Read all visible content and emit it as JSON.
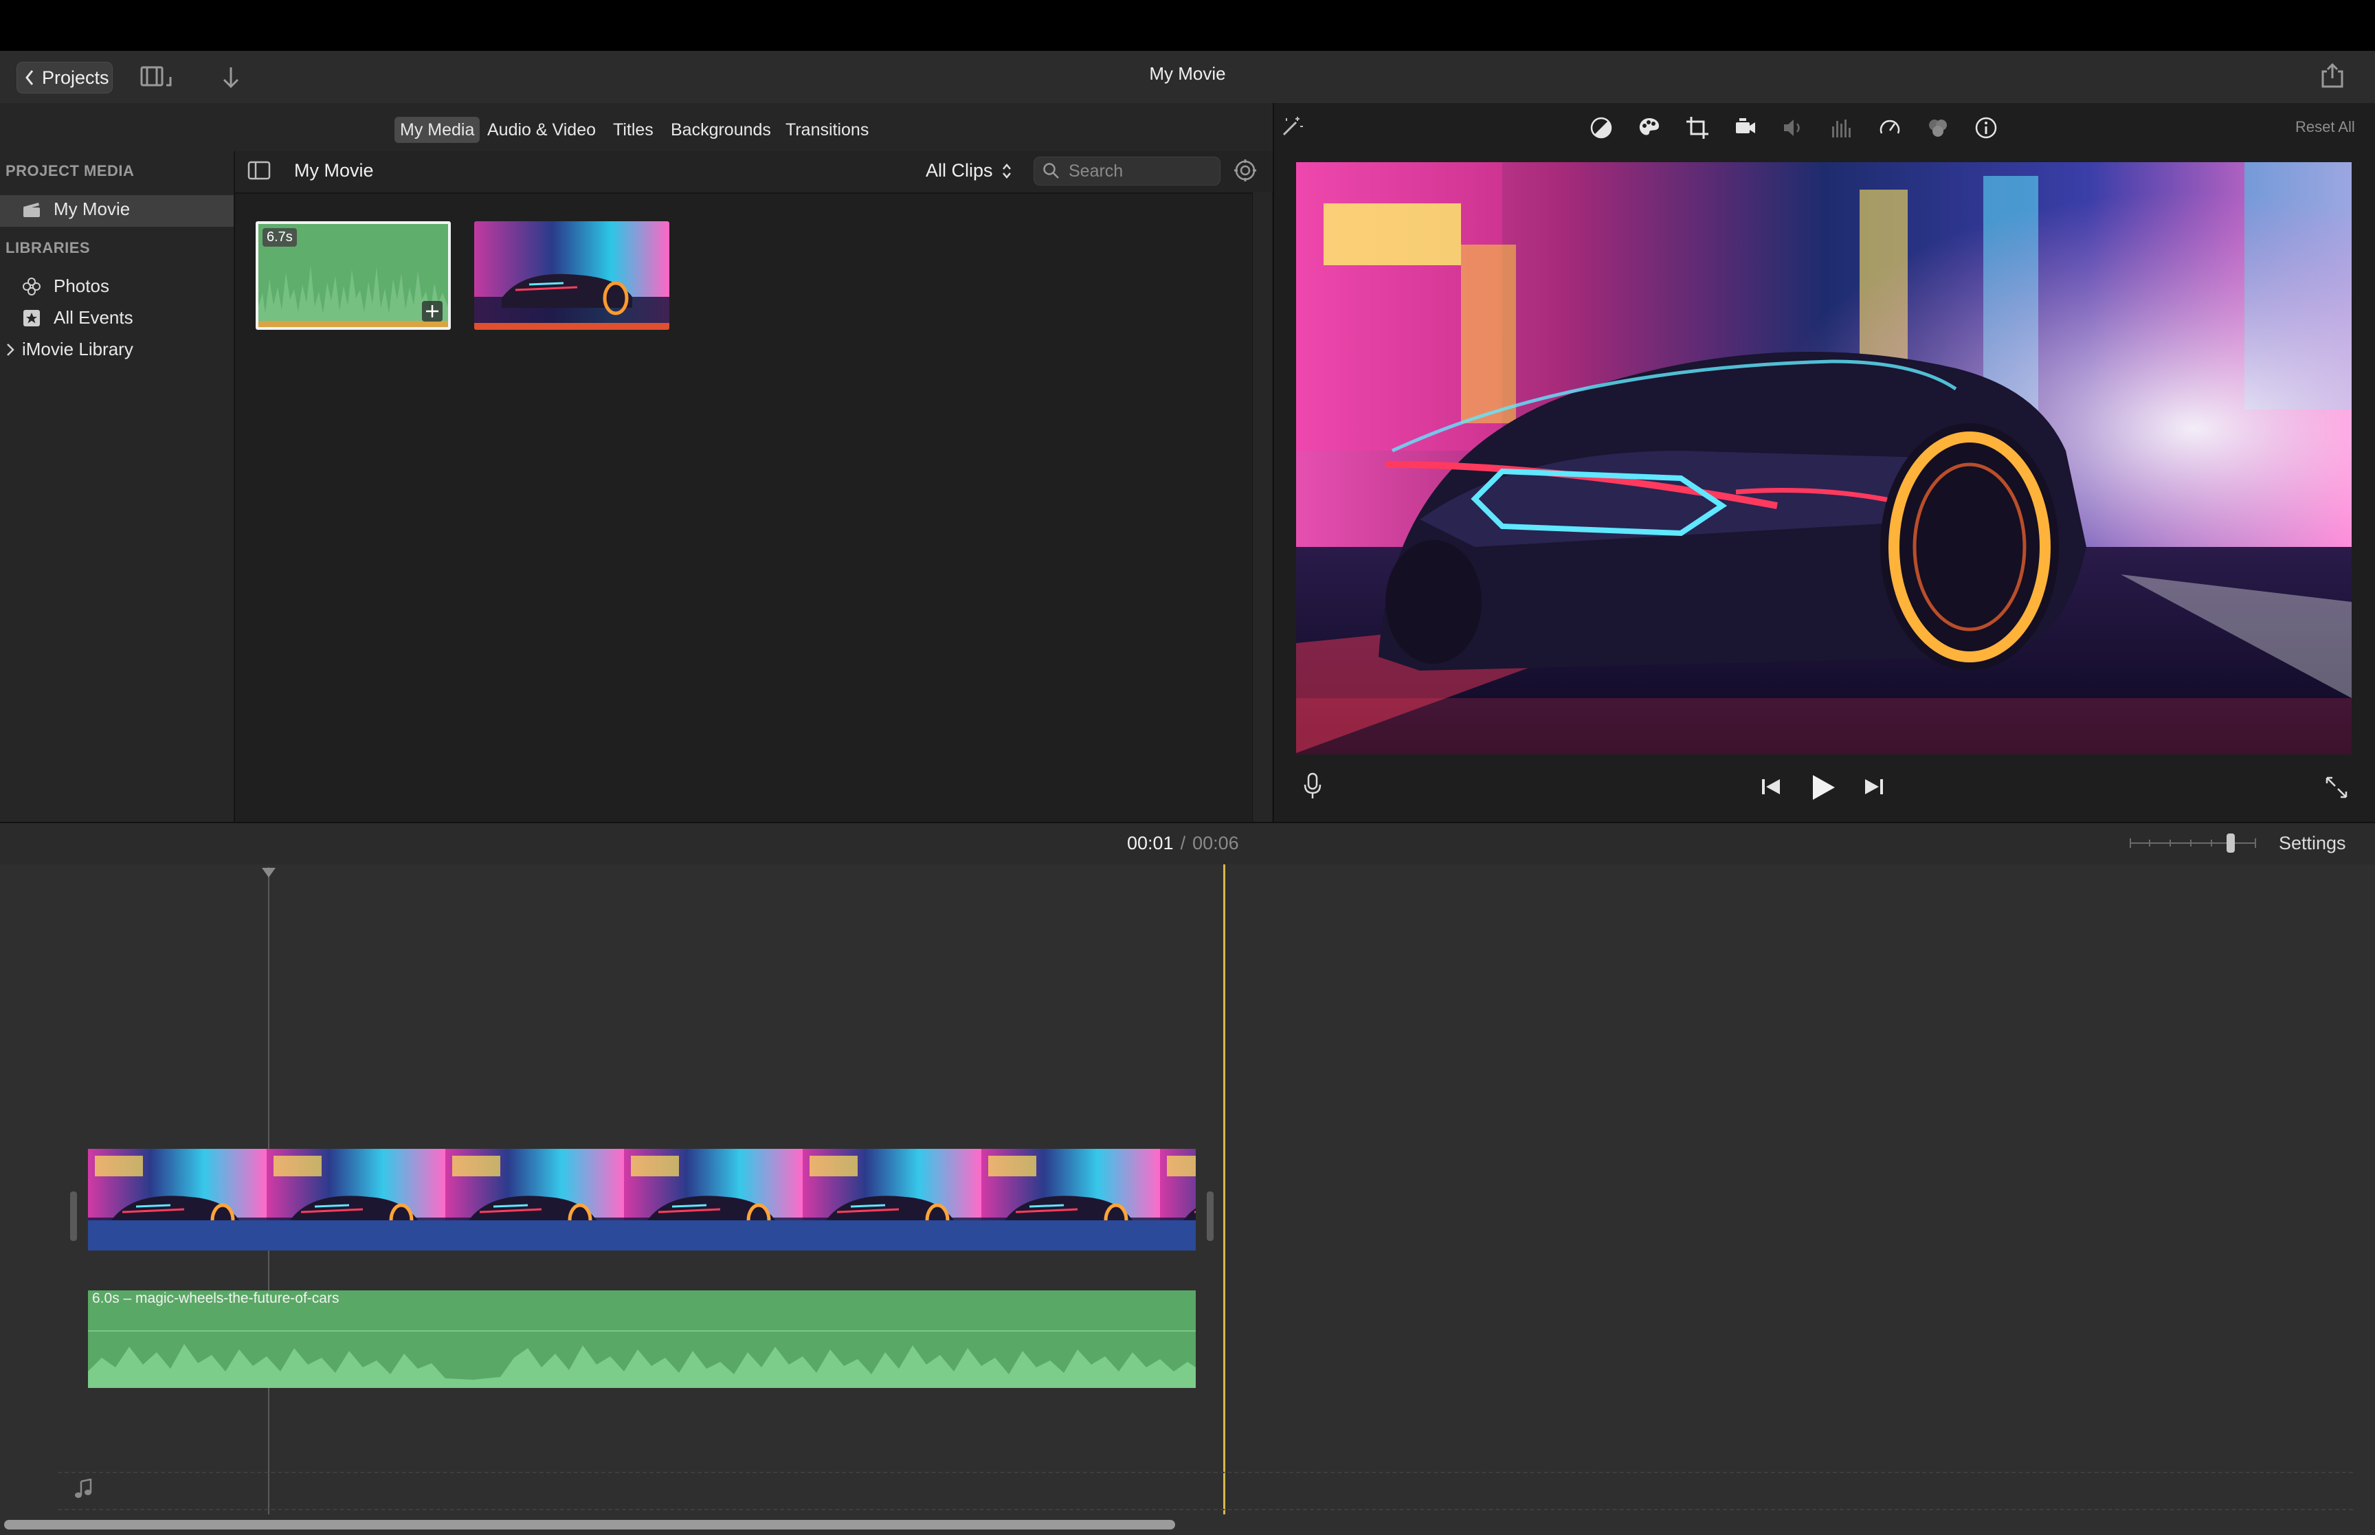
{
  "window": {
    "title": "My Movie"
  },
  "toolbar": {
    "projects_label": "Projects"
  },
  "tabs": [
    "My Media",
    "Audio & Video",
    "Titles",
    "Backgrounds",
    "Transitions"
  ],
  "sidebar": {
    "project_media_heading": "PROJECT MEDIA",
    "project_item": "My Movie",
    "libraries_heading": "LIBRARIES",
    "photos": "Photos",
    "all_events": "All Events",
    "imovie_library": "iMovie Library"
  },
  "browser": {
    "title": "My Movie",
    "filter": "All Clips",
    "search_placeholder": "Search",
    "clips": [
      {
        "duration_badge": "6.7s",
        "kind": "audio"
      },
      {
        "kind": "video"
      }
    ]
  },
  "viewer": {
    "reset_all": "Reset All"
  },
  "timeline": {
    "current_time": "00:01",
    "separator": "/",
    "total_time": "00:06",
    "settings": "Settings",
    "audio_clip_label": "6.0s – magic-wheels-the-future-of-cars"
  },
  "colors": {
    "playhead": "#d8b84a",
    "audio_clip": "#5aa865",
    "video_audio_band": "#2b4a9a"
  }
}
